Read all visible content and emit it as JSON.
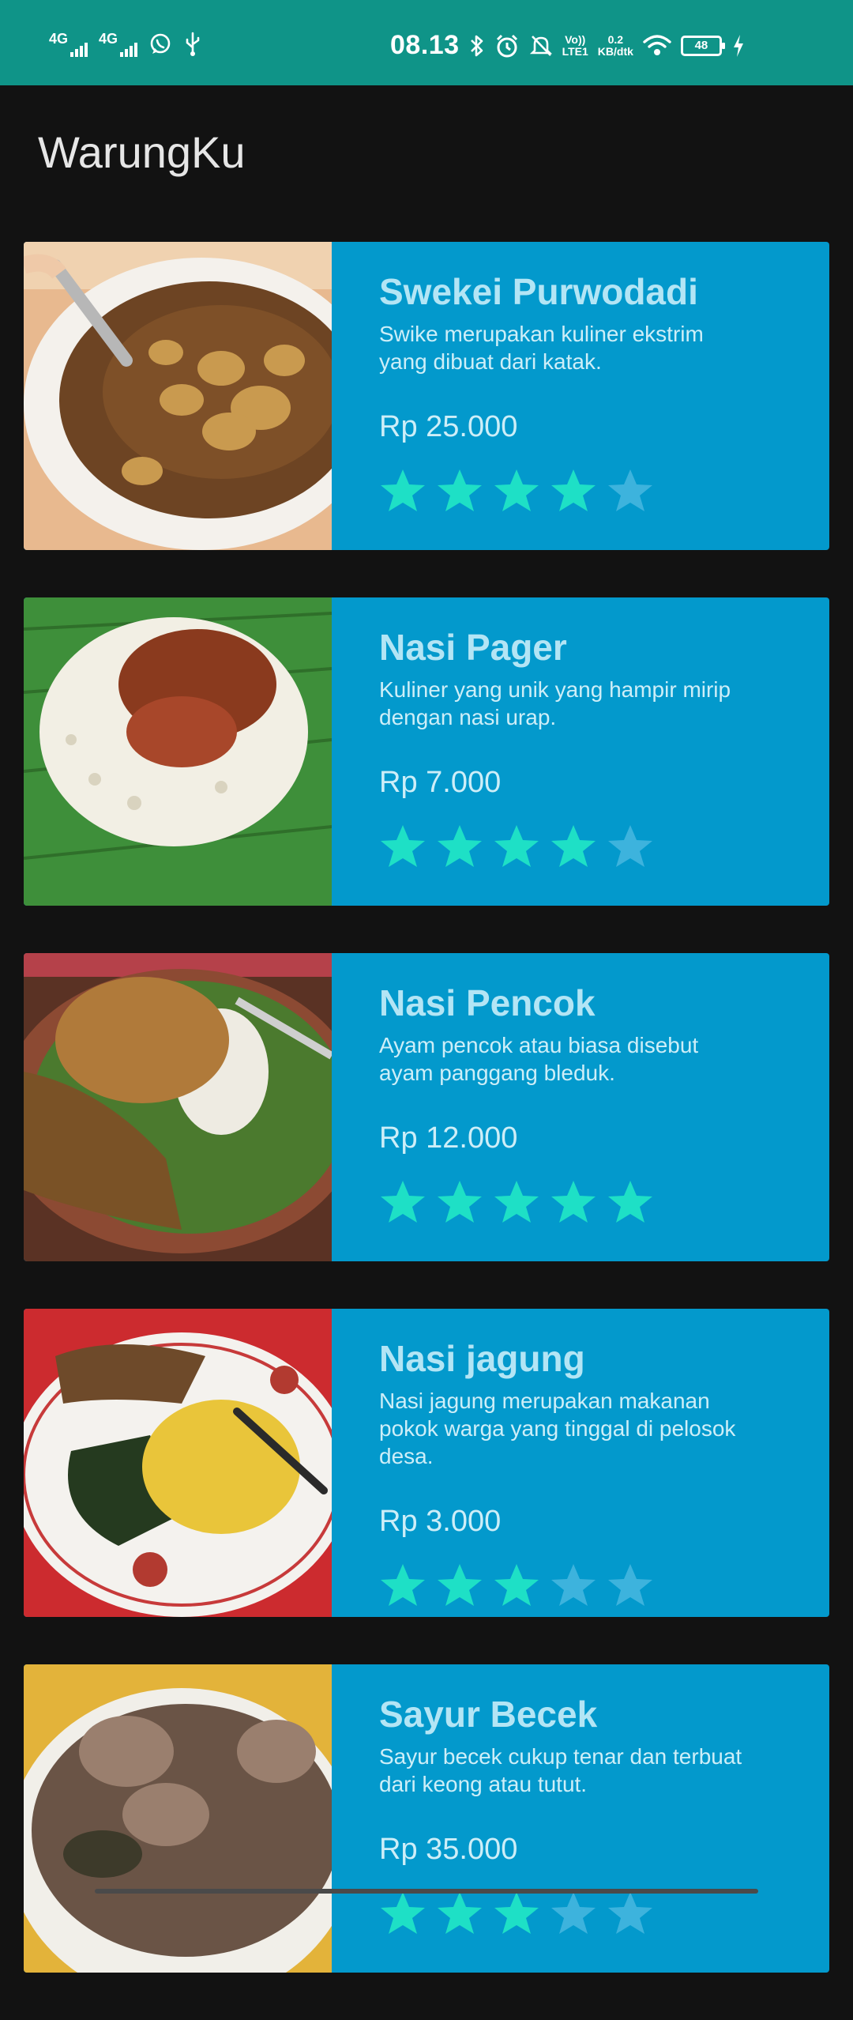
{
  "status_bar": {
    "net1": "4G",
    "net2": "4G",
    "time": "08.13",
    "volte_top": "Vo))",
    "volte_bottom": "LTE1",
    "speed_top": "0.2",
    "speed_bottom": "KB/dtk",
    "battery": "48"
  },
  "app": {
    "title": "WarungKu"
  },
  "colors": {
    "status_bar": "#0f9488",
    "background": "#121212",
    "card": "#0399cc",
    "star_filled": "#1ee0c6",
    "star_empty": "#3db3dd"
  },
  "items": [
    {
      "name": "Swekei Purwodadi",
      "desc": "Swike merupakan kuliner ekstrim yang dibuat dari katak.",
      "price": "Rp 25.000",
      "rating": 4,
      "image": "swike-bowl"
    },
    {
      "name": "Nasi Pager",
      "desc": "Kuliner yang unik yang hampir mirip dengan nasi urap.",
      "price": "Rp 7.000",
      "rating": 4,
      "image": "nasi-pager-leaf"
    },
    {
      "name": "Nasi Pencok",
      "desc": "Ayam pencok atau biasa disebut ayam panggang bleduk.",
      "price": "Rp 12.000",
      "rating": 5,
      "image": "nasi-pencok-plate"
    },
    {
      "name": "Nasi jagung",
      "desc": "Nasi jagung merupakan makanan pokok warga yang tinggal di pelosok desa.",
      "price": "Rp 3.000",
      "rating": 3,
      "image": "nasi-jagung-plate"
    },
    {
      "name": "Sayur Becek",
      "desc": "Sayur becek cukup tenar dan terbuat dari keong atau tutut.",
      "price": "Rp 35.000",
      "rating": 3,
      "image": "sayur-becek-bowl"
    }
  ]
}
